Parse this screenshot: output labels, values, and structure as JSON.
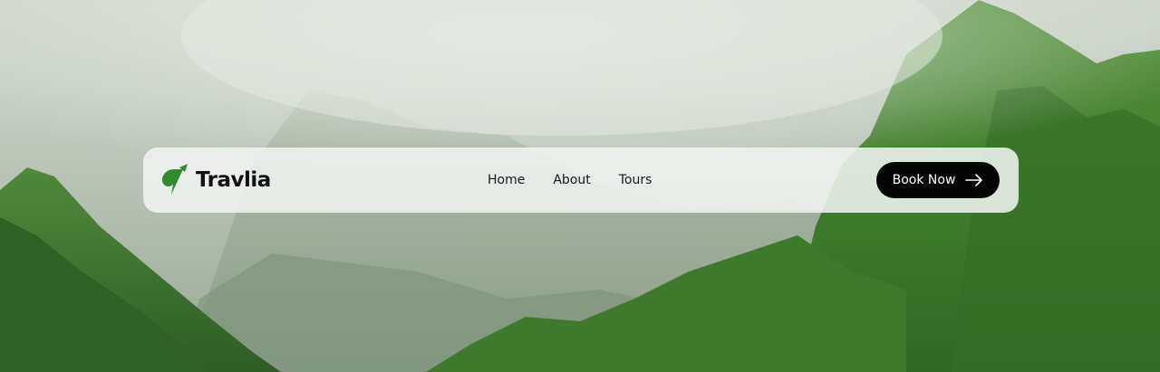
{
  "brand": {
    "name": "Travlia",
    "logo_icon": "leaf-logo-icon",
    "logo_color": "#2e8b2e"
  },
  "nav": {
    "items": [
      {
        "label": "Home"
      },
      {
        "label": "About"
      },
      {
        "label": "Tours"
      }
    ]
  },
  "cta": {
    "label": "Book Now",
    "icon": "arrow-right-icon",
    "background": "#050505",
    "text_color": "#ffffff"
  },
  "background": {
    "description_icon": "mountain-landscape-image",
    "sky_color": "#c9d1c7",
    "forest_color": "#3f7a2a"
  }
}
